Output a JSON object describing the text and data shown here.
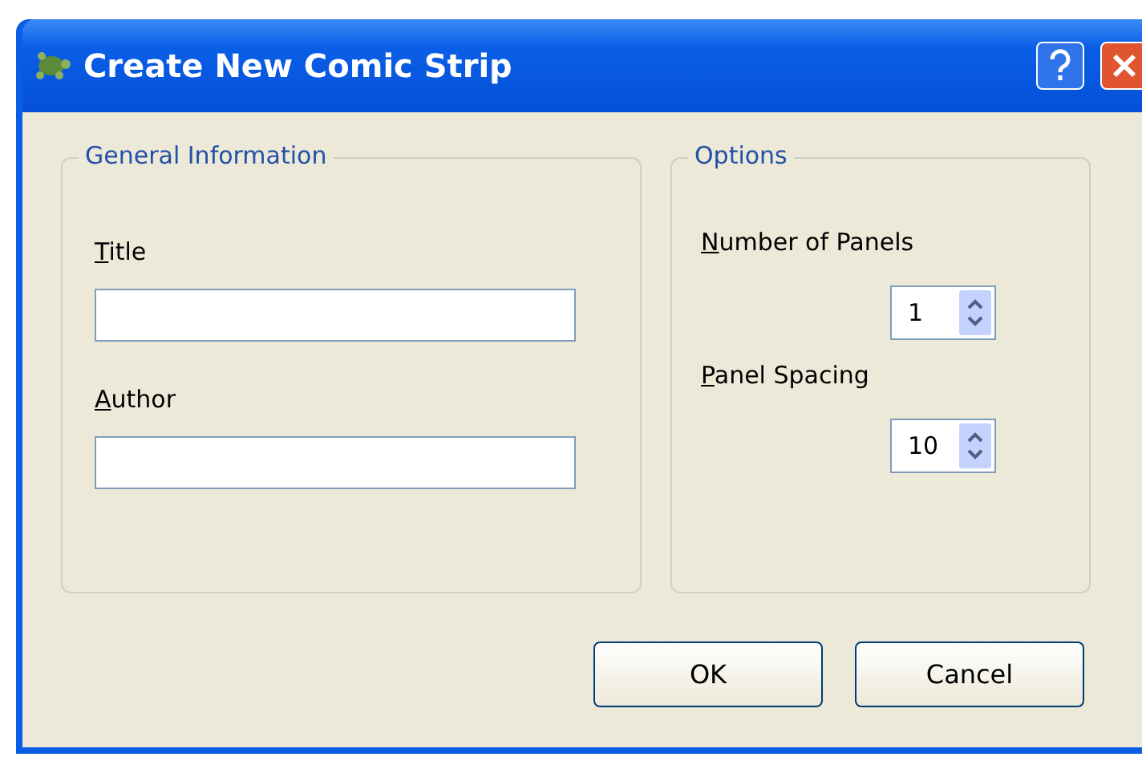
{
  "window": {
    "title": "Create New Comic Strip"
  },
  "general": {
    "legend": "General Information",
    "fields": [
      {
        "label": "Title",
        "mnemonic": true
      },
      {
        "label": "Author",
        "mnemonic": true
      }
    ]
  },
  "options": {
    "legend": "Options",
    "spinners": [
      {
        "label": "Number of Panels",
        "mnemonic": true,
        "value": "1"
      },
      {
        "label": "Panel Spacing",
        "mnemonic": true,
        "value": "10"
      }
    ]
  },
  "buttons": [
    {
      "label": "OK"
    },
    {
      "label": "Cancel"
    }
  ]
}
